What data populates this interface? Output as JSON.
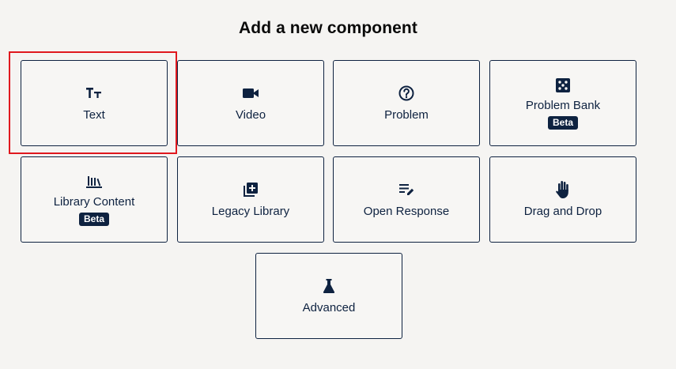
{
  "header": {
    "title": "Add a new component"
  },
  "components": {
    "text": {
      "label": "Text",
      "icon": "text-format-icon"
    },
    "video": {
      "label": "Video",
      "icon": "video-camera-icon"
    },
    "problem": {
      "label": "Problem",
      "icon": "question-circle-icon"
    },
    "problem_bank": {
      "label": "Problem Bank",
      "icon": "dice-icon",
      "badge": "Beta"
    },
    "library": {
      "label": "Library Content",
      "icon": "library-books-icon",
      "badge": "Beta"
    },
    "legacy": {
      "label": "Legacy Library",
      "icon": "library-add-icon"
    },
    "open_resp": {
      "label": "Open Response",
      "icon": "edit-note-icon"
    },
    "drag_drop": {
      "label": "Drag and Drop",
      "icon": "hand-icon"
    },
    "advanced": {
      "label": "Advanced",
      "icon": "flask-icon"
    }
  },
  "colors": {
    "brand": "#0e2240",
    "highlight": "#e0181e",
    "background": "#f5f4f2"
  }
}
